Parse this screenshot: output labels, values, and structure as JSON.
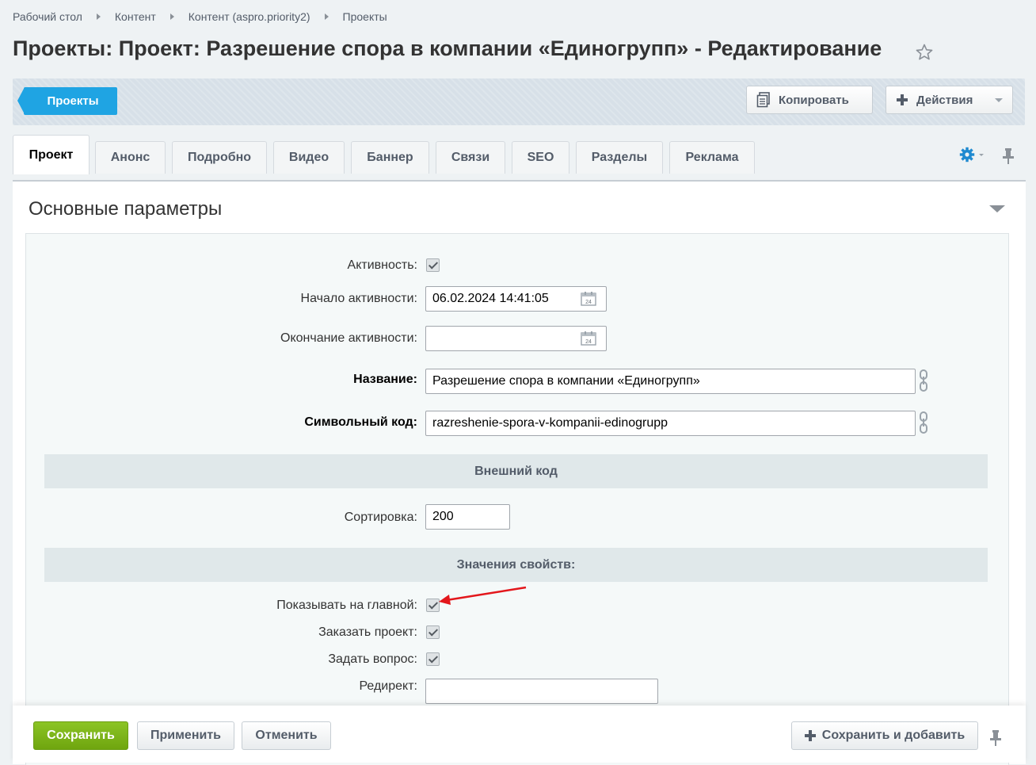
{
  "breadcrumb": [
    "Рабочий стол",
    "Контент",
    "Контент (aspro.priority2)",
    "Проекты"
  ],
  "page_title": "Проекты: Проект: Разрешение спора в компании «Единогрупп» - Редактирование",
  "toolbar": {
    "back_label": "Проекты",
    "copy_label": "Копировать",
    "actions_label": "Действия"
  },
  "tabs": [
    "Проект",
    "Анонс",
    "Подробно",
    "Видео",
    "Баннер",
    "Связи",
    "SEO",
    "Разделы",
    "Реклама"
  ],
  "active_tab": "Проект",
  "section_title": "Основные параметры",
  "fields": {
    "active_label": "Активность:",
    "active_checked": true,
    "start_label": "Начало активности:",
    "start_value": "06.02.2024 14:41:05",
    "end_label": "Окончание активности:",
    "end_value": "",
    "name_label": "Название:",
    "name_value": "Разрешение спора в компании «Единогрупп»",
    "code_label": "Символьный код:",
    "code_value": "razreshenie-spora-v-kompanii-edinogrupp",
    "external_code_header": "Внешний код",
    "sort_label": "Сортировка:",
    "sort_value": "200",
    "properties_header": "Значения свойств:",
    "show_main_label": "Показывать на главной:",
    "show_main_checked": true,
    "order_label": "Заказать проект:",
    "order_checked": true,
    "question_label": "Задать вопрос:",
    "question_checked": true,
    "redirect_label": "Редирект:",
    "redirect_value": ""
  },
  "footer": {
    "save_label": "Сохранить",
    "apply_label": "Применить",
    "cancel_label": "Отменить",
    "save_add_label": "Сохранить и добавить"
  },
  "colors": {
    "accent_blue": "#1fa4e3",
    "save_green": "#7ab41c",
    "annotation_arrow": "#e3171c"
  },
  "icons": [
    "star-icon",
    "copy-icon",
    "plus-icon",
    "gear-icon",
    "pin-icon",
    "calendar-icon",
    "chain-icon",
    "collapse-arrow-icon"
  ]
}
